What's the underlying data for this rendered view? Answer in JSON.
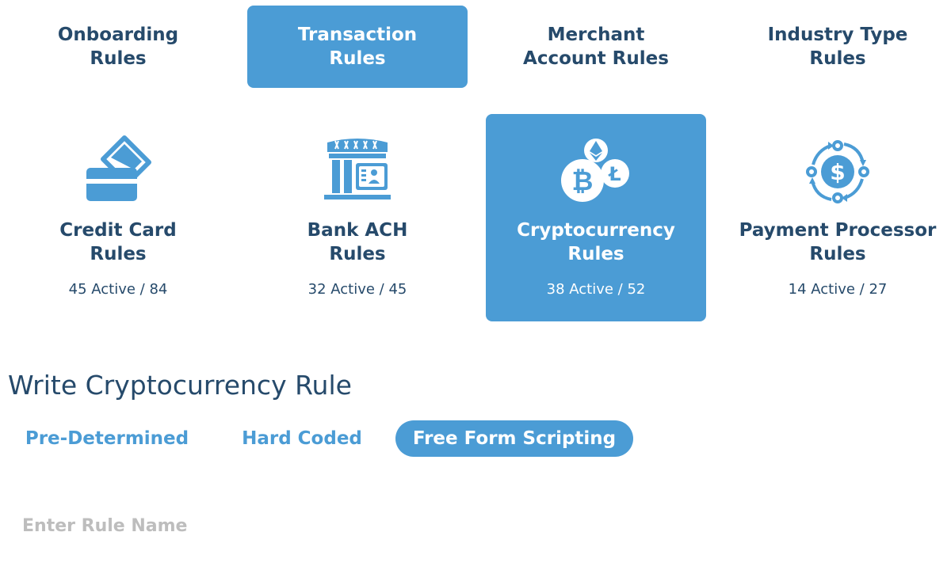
{
  "top_tabs": [
    {
      "label": "Onboarding\nRules",
      "active": false
    },
    {
      "label": "Transaction\nRules",
      "active": true
    },
    {
      "label": "Merchant\nAccount Rules",
      "active": false
    },
    {
      "label": "Industry Type\nRules",
      "active": false
    }
  ],
  "rule_cards": [
    {
      "icon": "credit-card-icon",
      "title": "Credit Card\nRules",
      "count": "45 Active / 84",
      "active": false
    },
    {
      "icon": "bank-icon",
      "title": "Bank ACH\nRules",
      "count": "32 Active / 45",
      "active": false
    },
    {
      "icon": "cryptocurrency-icon",
      "title": "Cryptocurrency\nRules",
      "count": "38 Active / 52",
      "active": true
    },
    {
      "icon": "payment-processor-icon",
      "title": "Payment Processor\nRules",
      "count": "14 Active / 27",
      "active": false
    }
  ],
  "editor": {
    "title": "Write Cryptocurrency Rule",
    "modes": [
      {
        "label": "Pre-Determined",
        "active": false
      },
      {
        "label": "Hard Coded",
        "active": false
      },
      {
        "label": "Free Form Scripting",
        "active": true
      }
    ],
    "rule_name_placeholder": "Enter Rule Name",
    "rule_name_value": ""
  },
  "colors": {
    "accent": "#4b9cd5",
    "text_dark": "#264a6b",
    "placeholder": "#bdbdbd"
  }
}
